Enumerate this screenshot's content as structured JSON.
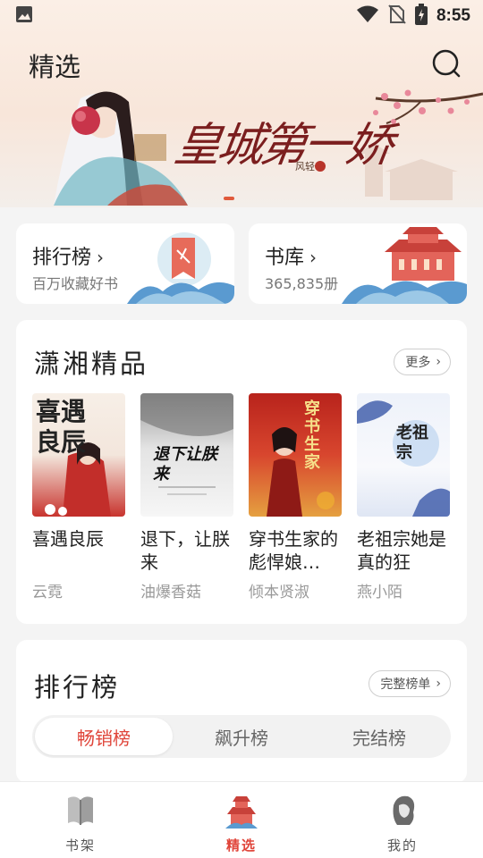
{
  "status_bar": {
    "time": "8:55",
    "icons": [
      "image-icon",
      "wifi-icon",
      "no-sim-icon",
      "battery-charging-icon"
    ]
  },
  "header": {
    "title": "精选",
    "search_icon": "search-icon"
  },
  "banner": {
    "title": "皇城第一娇",
    "author": "风轻"
  },
  "quick_cards": [
    {
      "title": "排行榜",
      "subtitle": "百万收藏好书"
    },
    {
      "title": "书库",
      "subtitle": "365,835册"
    }
  ],
  "section_featured": {
    "title": "潇湘精品",
    "more_label": "更多",
    "books": [
      {
        "title": "喜遇良辰",
        "author": "云霓",
        "cover_text": "喜遇良辰"
      },
      {
        "title": "退下，让朕来",
        "author": "油爆香菇",
        "cover_text": "退下让朕来"
      },
      {
        "title": "穿书生家的彪悍娘…",
        "author": "倾本贤淑",
        "cover_text": "穿书生家"
      },
      {
        "title": "老祖宗她是真的狂",
        "author": "燕小陌",
        "cover_text": "老祖宗"
      }
    ]
  },
  "section_ranking": {
    "title": "排行榜",
    "more_label": "完整榜单",
    "tabs": [
      {
        "label": "畅销榜",
        "active": true
      },
      {
        "label": "飙升榜",
        "active": false
      },
      {
        "label": "完结榜",
        "active": false
      }
    ]
  },
  "bottom_nav": [
    {
      "label": "书架",
      "icon": "bookshelf-icon",
      "active": false
    },
    {
      "label": "精选",
      "icon": "featured-icon",
      "active": true
    },
    {
      "label": "我的",
      "icon": "profile-icon",
      "active": false
    }
  ],
  "colors": {
    "accent": "#e0453a",
    "background": "#f4f4f4",
    "banner_gradient_top": "#fbefe6"
  }
}
